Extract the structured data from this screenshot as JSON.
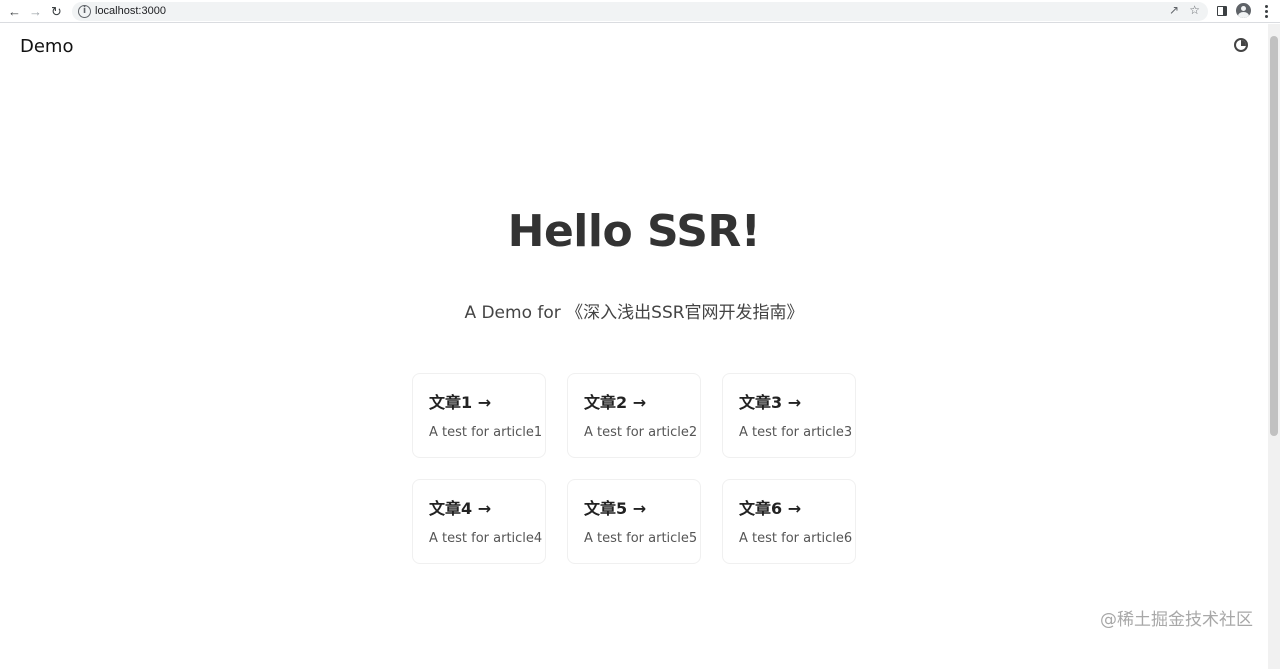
{
  "browser": {
    "url": "localhost:3000",
    "back_icon": "arrow-left-icon",
    "forward_icon": "arrow-right-icon",
    "reload_icon": "reload-icon"
  },
  "header": {
    "site_title": "Demo",
    "theme_icon": "half-circle-theme-icon"
  },
  "hero": {
    "title": "Hello SSR!",
    "subtitle": "A Demo for 《深入浅出SSR官网开发指南》"
  },
  "articles": [
    {
      "title": "文章1 →",
      "desc": "A test for article1"
    },
    {
      "title": "文章2 →",
      "desc": "A test for article2"
    },
    {
      "title": "文章3 →",
      "desc": "A test for article3"
    },
    {
      "title": "文章4 →",
      "desc": "A test for article4"
    },
    {
      "title": "文章5 →",
      "desc": "A test for article5"
    },
    {
      "title": "文章6 →",
      "desc": "A test for article6"
    }
  ],
  "watermark": "@稀土掘金技术社区"
}
